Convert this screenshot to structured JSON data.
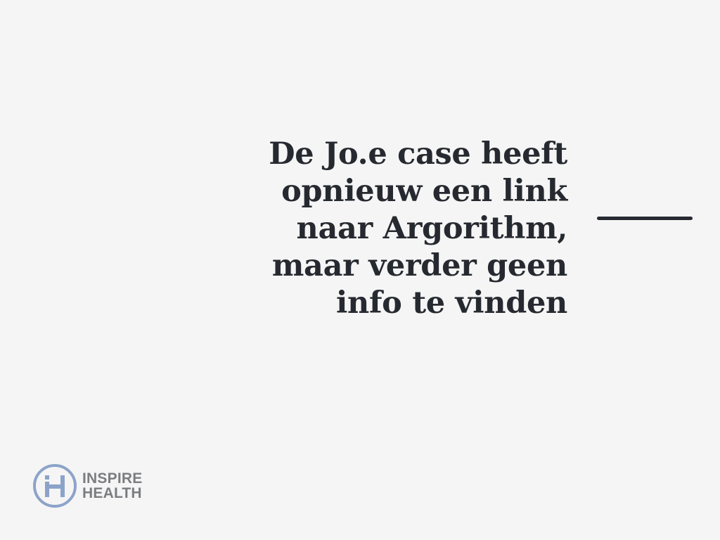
{
  "slide": {
    "headline_lines": [
      "De Jo.e case heeft",
      "opnieuw een link",
      "naar Argorithm,",
      "maar verder geen",
      "info te vinden"
    ]
  },
  "brand": {
    "name_line1": "INSPIRE",
    "name_line2": "HEALTH",
    "logo_icon": "inspire-health-logo-icon"
  },
  "colors": {
    "background": "#f5f5f5",
    "text": "#262a30",
    "logo_blue": "#8ca3c9",
    "logo_text": "#7b7d81"
  }
}
